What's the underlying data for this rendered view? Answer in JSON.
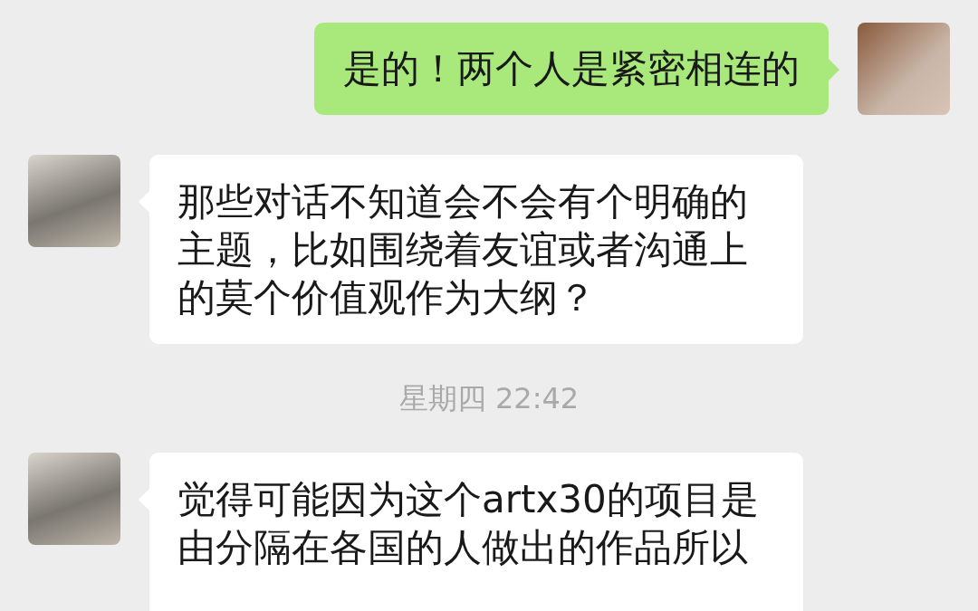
{
  "messages": [
    {
      "kind": "sent",
      "text": "是的！两个人是紧密相连的"
    },
    {
      "kind": "received",
      "text": "那些对话不知道会不会有个明确的主题，比如围绕着友谊或者沟通上的莫个价值观作为大纲？"
    },
    {
      "kind": "time",
      "text": "星期四 22:42"
    },
    {
      "kind": "received",
      "text": "觉得可能因为这个artx30的项目是由分隔在各国的人做出的作品所以"
    }
  ]
}
